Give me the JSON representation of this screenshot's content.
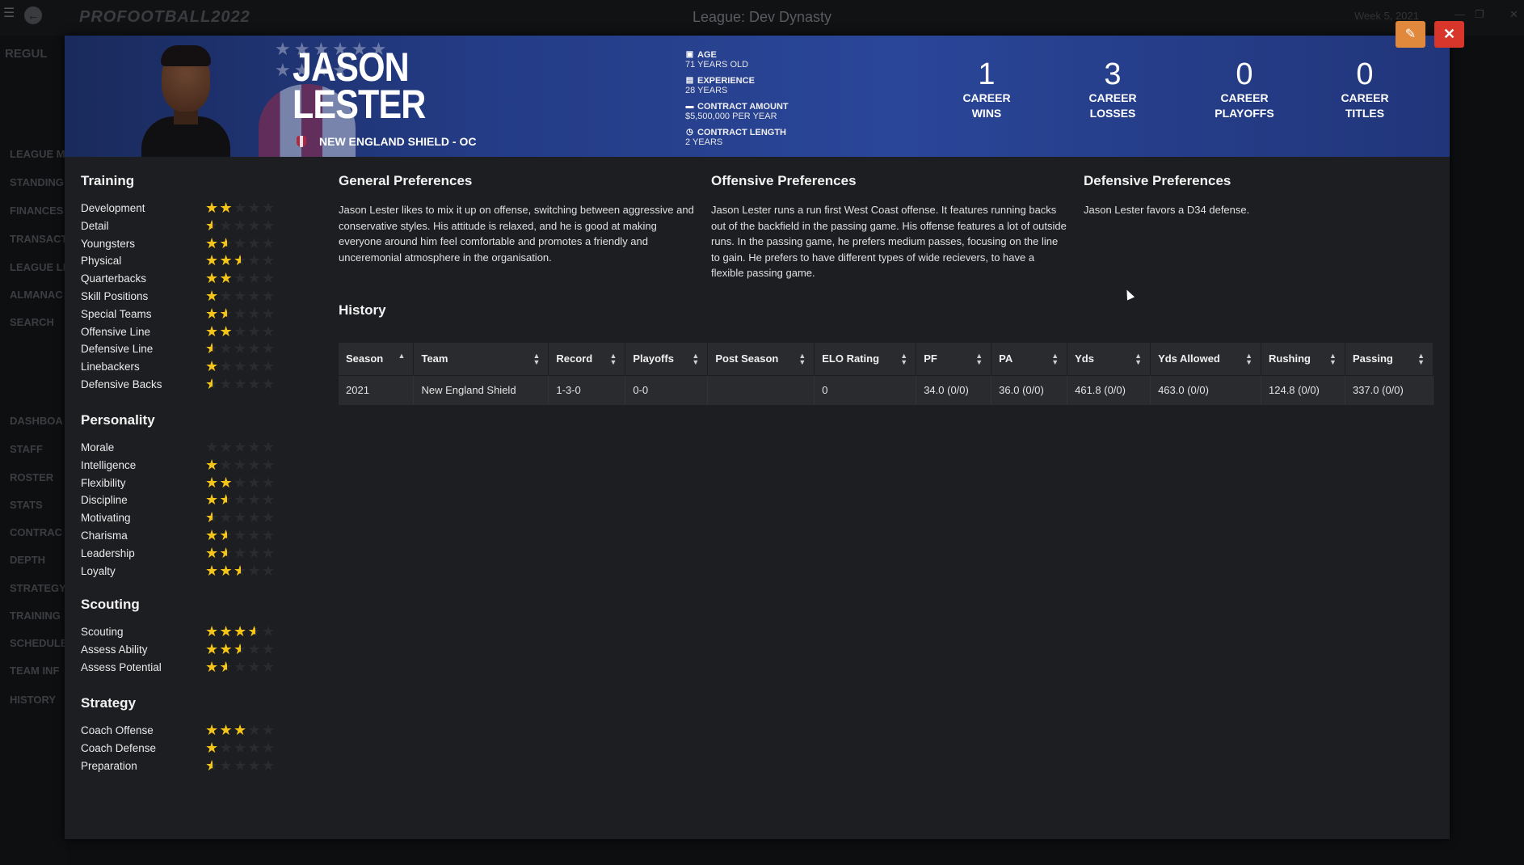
{
  "app": {
    "league_title": "League: Dev Dynasty",
    "logo_text": "PROFOOTBALL2022",
    "week": "Week 5, 2021",
    "season_label": "REGUL"
  },
  "background_nav": [
    "LEAGUE M",
    "STANDING",
    "FINANCES",
    "TRANSACT",
    "LEAGUE LE",
    "ALMANAC",
    "SEARCH",
    "DASHBOA",
    "STAFF",
    "ROSTER",
    "STATS",
    "CONTRAC",
    "DEPTH",
    "STRATEGY",
    "TRAINING",
    "SCHEDULE",
    "TEAM INF",
    "HISTORY"
  ],
  "coach": {
    "first_name": "JASON",
    "last_name": "LESTER",
    "team_line": "NEW ENGLAND SHIELD - OC",
    "age_label": "AGE",
    "age_value": "71 YEARS OLD",
    "experience_label": "EXPERIENCE",
    "experience_value": "28 YEARS",
    "contract_amount_label": "CONTRACT AMOUNT",
    "contract_amount_value": "$5,500,000 PER YEAR",
    "contract_length_label": "CONTRACT LENGTH",
    "contract_length_value": "2 YEARS"
  },
  "career": [
    {
      "num": "1",
      "line1": "CAREER",
      "line2": "WINS"
    },
    {
      "num": "3",
      "line1": "CAREER",
      "line2": "LOSSES"
    },
    {
      "num": "0",
      "line1": "CAREER",
      "line2": "PLAYOFFS"
    },
    {
      "num": "0",
      "line1": "CAREER",
      "line2": "TITLES"
    }
  ],
  "icons": {
    "edit": "edit-icon",
    "close": "close-icon",
    "age": "id-card-icon",
    "experience": "briefcase-icon",
    "contract_amount": "money-icon",
    "contract_length": "clock-icon",
    "sort": "sort-icon"
  },
  "colors": {
    "star": "#f5c518",
    "edit_button": "#e0893c",
    "close_button": "#d9362b",
    "header_blue": "#2a4698"
  },
  "sections": [
    {
      "title": "Training",
      "items": [
        {
          "label": "Development",
          "stars": 2
        },
        {
          "label": "Detail",
          "stars": 0.5
        },
        {
          "label": "Youngsters",
          "stars": 1.5
        },
        {
          "label": "Physical",
          "stars": 2.5
        },
        {
          "label": "Quarterbacks",
          "stars": 2
        },
        {
          "label": "Skill Positions",
          "stars": 1
        },
        {
          "label": "Special Teams",
          "stars": 1.5
        },
        {
          "label": "Offensive Line",
          "stars": 2
        },
        {
          "label": "Defensive Line",
          "stars": 0.5
        },
        {
          "label": "Linebackers",
          "stars": 1
        },
        {
          "label": "Defensive Backs",
          "stars": 0.5
        }
      ]
    },
    {
      "title": "Personality",
      "items": [
        {
          "label": "Morale",
          "stars": 0
        },
        {
          "label": "Intelligence",
          "stars": 1
        },
        {
          "label": "Flexibility",
          "stars": 2
        },
        {
          "label": "Discipline",
          "stars": 1.5
        },
        {
          "label": "Motivating",
          "stars": 0.5
        },
        {
          "label": "Charisma",
          "stars": 1.5
        },
        {
          "label": "Leadership",
          "stars": 1.5
        },
        {
          "label": "Loyalty",
          "stars": 2.5
        }
      ]
    },
    {
      "title": "Scouting",
      "items": [
        {
          "label": "Scouting",
          "stars": 3.5
        },
        {
          "label": "Assess Ability",
          "stars": 2.5
        },
        {
          "label": "Assess Potential",
          "stars": 1.5
        }
      ]
    },
    {
      "title": "Strategy",
      "items": [
        {
          "label": "Coach Offense",
          "stars": 3
        },
        {
          "label": "Coach Defense",
          "stars": 1
        },
        {
          "label": "Preparation",
          "stars": 0.5
        }
      ]
    }
  ],
  "preferences": {
    "general_title": "General Preferences",
    "general_text": "Jason Lester likes to mix it up on offense, switching between aggressive and conservative styles. His attitude is relaxed, and he is good at making everyone around him feel comfortable and promotes a friendly and unceremonial atmosphere in the organisation.",
    "offensive_title": "Offensive Preferences",
    "offensive_text": "Jason Lester runs a run first West Coast offense. It features running backs out of the backfield in the passing game. His offense features a lot of outside runs. In the passing game, he prefers medium passes, focusing on the line to gain. He prefers to have different types of wide recievers, to have a flexible passing game.",
    "defensive_title": "Defensive Preferences",
    "defensive_text": "Jason Lester favors a D34 defense."
  },
  "history": {
    "title": "History",
    "columns": [
      "Season",
      "Team",
      "Record",
      "Playoffs",
      "Post Season",
      "ELO Rating",
      "PF",
      "PA",
      "Yds",
      "Yds Allowed",
      "Rushing",
      "Passing"
    ],
    "rows": [
      [
        "2021",
        "New England Shield",
        "1-3-0",
        "0-0",
        "",
        "0",
        "34.0 (0/0)",
        "36.0 (0/0)",
        "461.8 (0/0)",
        "463.0 (0/0)",
        "124.8 (0/0)",
        "337.0 (0/0)"
      ]
    ]
  }
}
